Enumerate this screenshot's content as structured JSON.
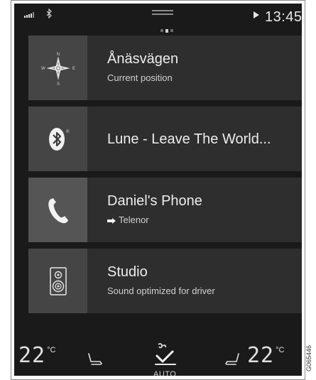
{
  "status_bar": {
    "time": "13:45",
    "icons": [
      "signal-icon",
      "bluetooth-icon",
      "navigation-arrow-icon"
    ]
  },
  "pager": {
    "pages": 3,
    "active_index": 1
  },
  "tiles": [
    {
      "title": "Ånäsvägen",
      "subtitle": "Current position",
      "icon": "compass-icon"
    },
    {
      "title": "Lune - Leave The World...",
      "subtitle": "",
      "icon": "bluetooth-icon"
    },
    {
      "title": "Daniel's Phone",
      "subtitle": "Telenor",
      "icon": "phone-icon"
    },
    {
      "title": "Studio",
      "subtitle": "Sound optimized for driver",
      "icon": "speaker-icon"
    }
  ],
  "climate": {
    "temp_left": "22",
    "temp_right": "22",
    "unit": "°C",
    "fan_mode": "AUTO"
  },
  "document_number": "G065446",
  "colors": {
    "screen_bg": "#1a1a1a",
    "tile_bg": "#2e2e2e",
    "icon_box_bg": "#454545",
    "text": "#ededed"
  }
}
